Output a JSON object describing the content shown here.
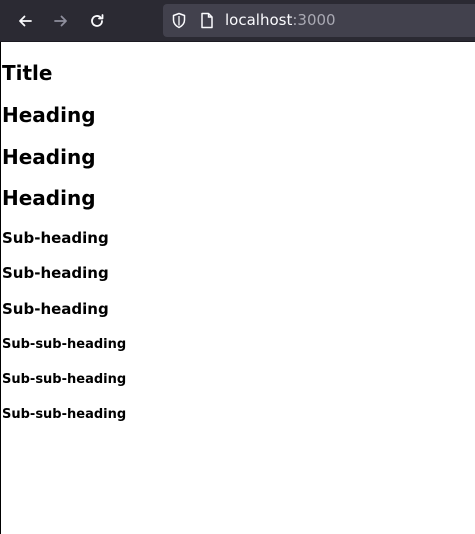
{
  "browser": {
    "url_host": "localhost",
    "url_port": ":3000",
    "icons": {
      "back": "arrow-left-icon",
      "forward": "arrow-right-icon",
      "reload": "reload-icon",
      "shield": "shield-icon",
      "page": "page-icon"
    }
  },
  "page": {
    "title": "Title",
    "headings": [
      "Heading",
      "Heading",
      "Heading"
    ],
    "subheadings": [
      "Sub-heading",
      "Sub-heading",
      "Sub-heading"
    ],
    "subsubheadings": [
      "Sub-sub-heading",
      "Sub-sub-heading",
      "Sub-sub-heading"
    ]
  }
}
